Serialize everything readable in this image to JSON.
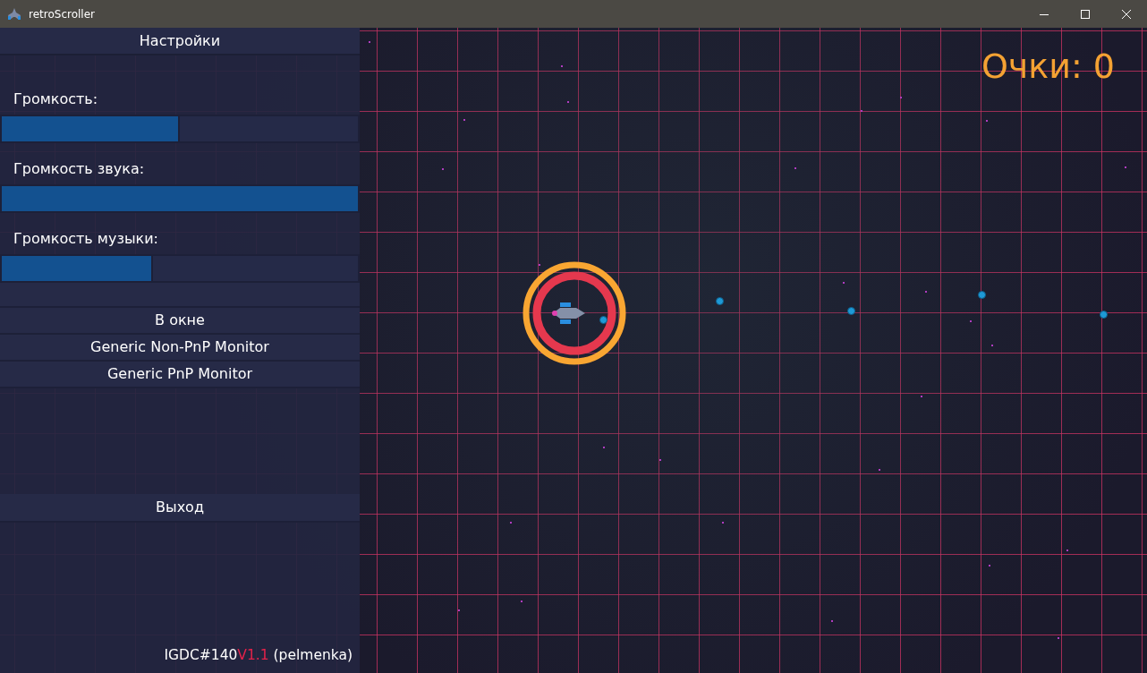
{
  "window": {
    "title": "retroScroller"
  },
  "settings": {
    "title": "Настройки",
    "sliders": [
      {
        "label": "Громкость:",
        "level": 0.5
      },
      {
        "label": "Громкость звука:",
        "level": 1.0
      },
      {
        "label": "Громкость музыки:",
        "level": 0.425
      }
    ],
    "display_modes": [
      "В окне",
      "Generic Non-PnP Monitor",
      "Generic PnP Monitor"
    ],
    "exit": "Выход",
    "credits": {
      "event": "IGDC#140",
      "version": "V1.1",
      "author": " (pelmenka)"
    }
  },
  "game": {
    "score": "Очки: 0"
  }
}
